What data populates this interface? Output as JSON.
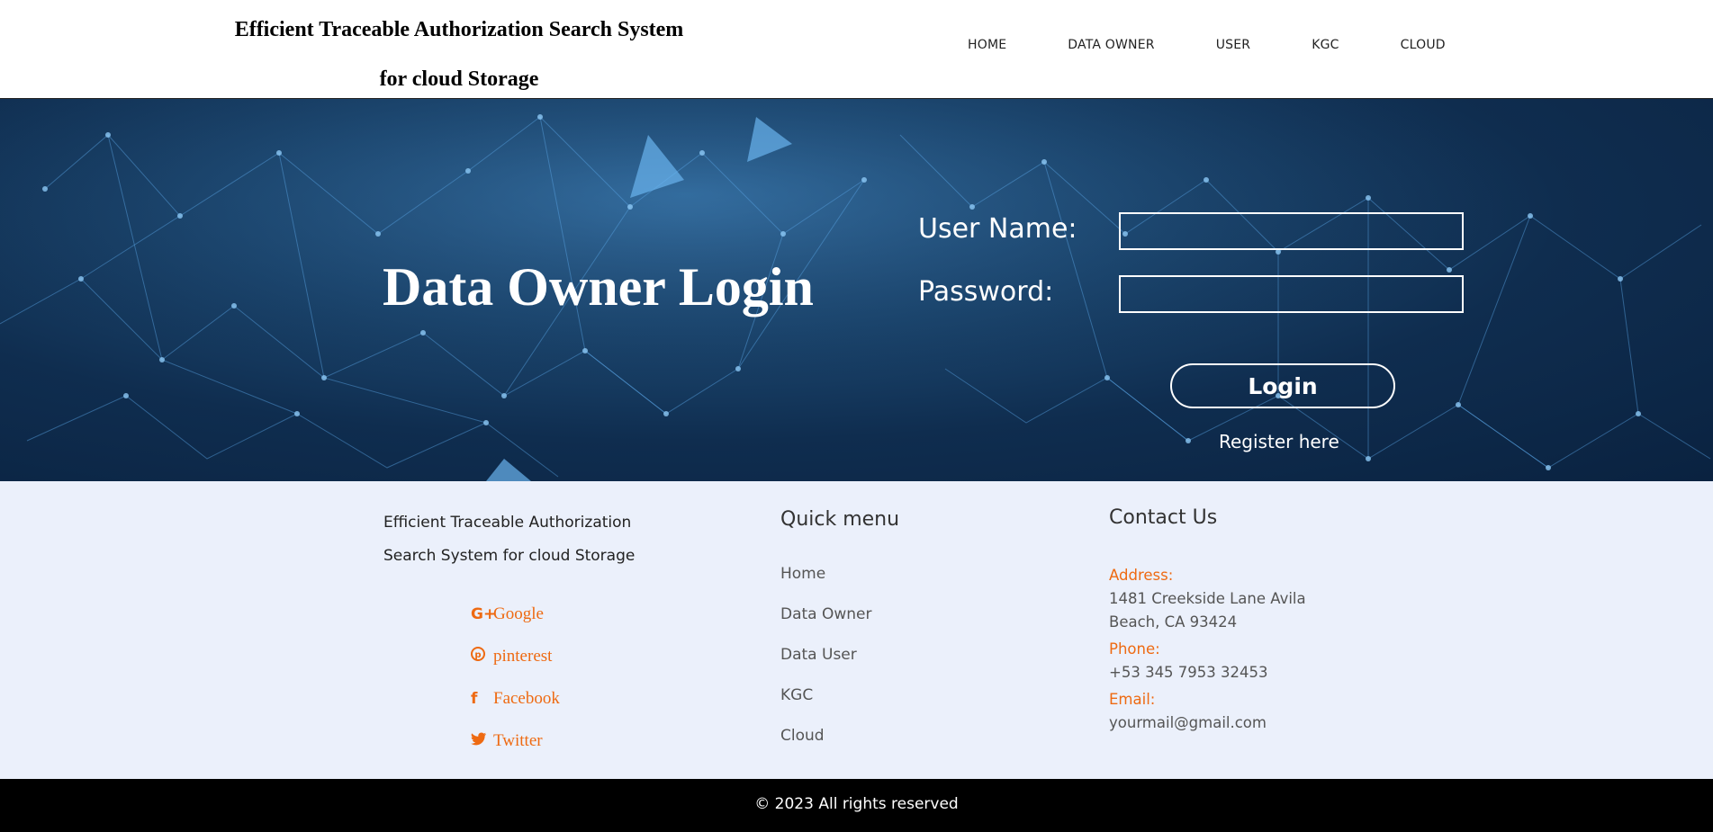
{
  "header": {
    "title_line1": "Efficient Traceable Authorization Search System",
    "title_line2": "for cloud Storage",
    "nav": [
      "HOME",
      "DATA OWNER",
      "USER",
      "KGC",
      "CLOUD"
    ]
  },
  "hero": {
    "heading": "Data Owner Login",
    "username_label": "User Name:",
    "password_label": "Password:",
    "username_value": "",
    "password_value": "",
    "login_label": "Login",
    "register_label": "Register here"
  },
  "footer": {
    "about_line1": "Efficient Traceable Authorization",
    "about_line2": "Search System for cloud Storage",
    "social": [
      {
        "icon": "google-plus-icon",
        "label": "Google"
      },
      {
        "icon": "pinterest-icon",
        "label": "pinterest"
      },
      {
        "icon": "facebook-icon",
        "label": "Facebook"
      },
      {
        "icon": "twitter-icon",
        "label": "Twitter"
      }
    ],
    "quick_menu_title": "Quick menu",
    "quick_menu": [
      "Home",
      "Data Owner",
      "Data User",
      "KGC",
      "Cloud"
    ],
    "contact_title": "Contact Us",
    "address_label": "Address:",
    "address_line1": "1481 Creekside Lane Avila",
    "address_line2": "Beach, CA 93424",
    "phone_label": "Phone:",
    "phone": "+53 345 7953 32453",
    "email_label": "Email:",
    "email": "yourmail@gmail.com"
  },
  "bottombar": {
    "copyright": "© 2023 All rights reserved"
  },
  "colors": {
    "accent": "#ee6a12",
    "hero_dark": "#0a2240",
    "footer_bg": "#ebf0fb"
  }
}
